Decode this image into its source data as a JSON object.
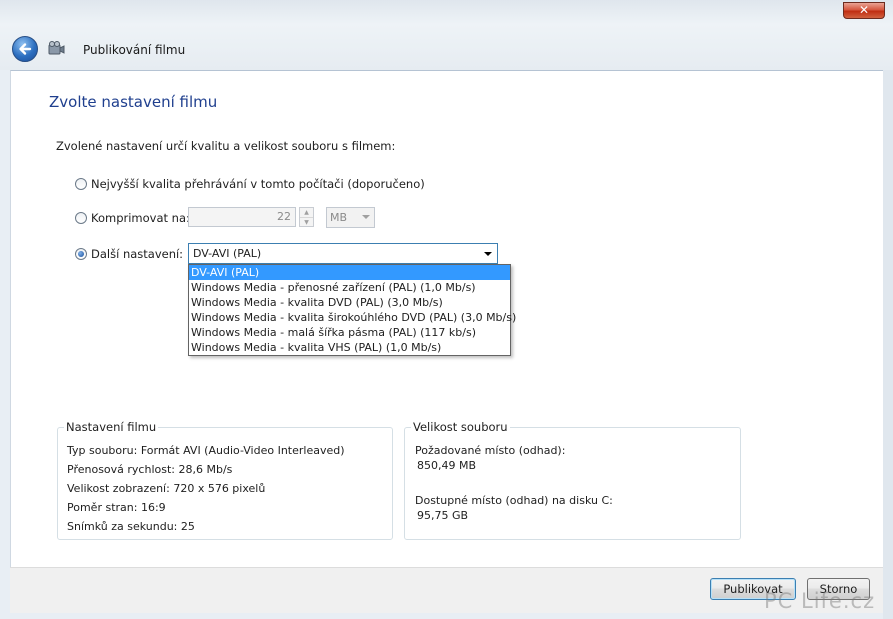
{
  "window": {
    "title": "Publikování filmu",
    "close_glyph": "✕",
    "back_icon": "back-arrow-icon",
    "app_icon": "movie-maker-icon"
  },
  "page": {
    "heading": "Zvolte nastavení filmu",
    "intro": "Zvolené nastavení určí kvalitu a velikost souboru s filmem:"
  },
  "options": {
    "best": {
      "label": "Nejvyšší kvalita přehrávání v tomto počítači (doporučeno)",
      "checked": false
    },
    "compress": {
      "label": "Komprimovat na:",
      "checked": false,
      "value": "22",
      "unit": "MB"
    },
    "other": {
      "label": "Další nastavení:",
      "checked": true,
      "selected": "DV-AVI (PAL)"
    }
  },
  "dropdown": {
    "items": [
      "DV-AVI (PAL)",
      "Windows Media - přenosné zařízení (PAL) (1,0 Mb/s)",
      "Windows Media - kvalita DVD (PAL) (3,0 Mb/s)",
      "Windows Media - kvalita širokoúhlého DVD (PAL) (3,0 Mb/s)",
      "Windows Media - malá šířka pásma (PAL) (117 kb/s)",
      "Windows Media - kvalita VHS (PAL) (1,0 Mb/s)"
    ],
    "selected_index": 0
  },
  "movie_settings": {
    "title": "Nastavení filmu",
    "lines": [
      "Typ souboru: Formát AVI (Audio-Video Interleaved)",
      "Přenosová rychlost: 28,6 Mb/s",
      "Velikost zobrazení: 720 x 576 pixelů",
      "Poměr stran: 16:9",
      "Snímků za sekundu: 25"
    ]
  },
  "file_size": {
    "title": "Velikost souboru",
    "required_label": "Požadované místo (odhad):",
    "required_value": "850,49 MB",
    "available_label": "Dostupné místo (odhad) na disku C:",
    "available_value": "95,75 GB"
  },
  "buttons": {
    "publish": "Publikovat",
    "cancel": "Storno"
  },
  "watermark": "PC Life.cz",
  "colors": {
    "heading": "#1f3f8e",
    "selection": "#3399ff",
    "focus_border": "#3c7fb1"
  }
}
